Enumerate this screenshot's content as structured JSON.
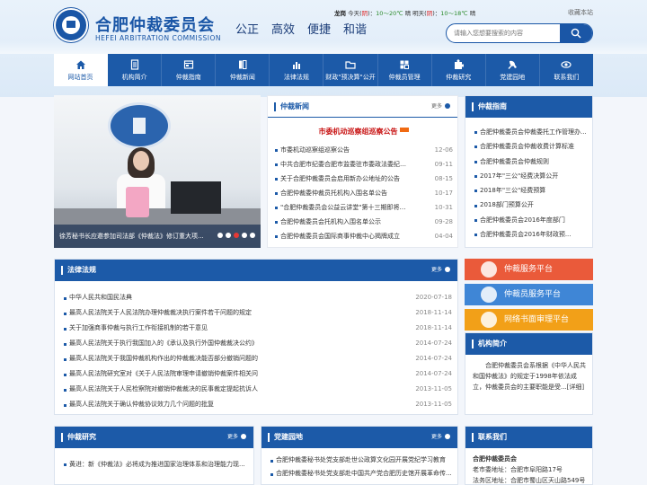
{
  "header": {
    "title": "合肥仲裁委员会",
    "subtitle": "HEFEI ARBITRATION COMMISSION",
    "slogans": [
      "公正",
      "高效",
      "便捷",
      "和谐"
    ],
    "weather": {
      "city": "龙岗",
      "today_label": "今天(",
      "today_cond": "阴",
      "today_close": ")：",
      "today_temp": "10～20℃",
      "today_word": "晴",
      "tomorrow_label": "明天(",
      "tomorrow_cond": "阴",
      "tomorrow_close": ")：",
      "tomorrow_temp": "10～18℃",
      "tomorrow_word": "晴"
    },
    "favorite": "收藏本站",
    "search_placeholder": "请输入您想要搜索的内容"
  },
  "nav": [
    {
      "label": "网站首页",
      "icon": "home-icon",
      "active": true
    },
    {
      "label": "机构简介",
      "icon": "document-icon"
    },
    {
      "label": "仲裁指南",
      "icon": "window-icon"
    },
    {
      "label": "仲裁新闻",
      "icon": "book-icon"
    },
    {
      "label": "法律法规",
      "icon": "chart-icon"
    },
    {
      "label": "财政\"预决算\"公开",
      "icon": "folder-icon"
    },
    {
      "label": "仲裁员管理",
      "icon": "pages-icon"
    },
    {
      "label": "仲裁研究",
      "icon": "puzzle-icon"
    },
    {
      "label": "党建园地",
      "icon": "party-icon"
    },
    {
      "label": "联系我们",
      "icon": "eye-icon"
    }
  ],
  "slider": {
    "caption": "徐芳秘书长应邀参加司法部《仲裁法》修订重大项..."
  },
  "news": {
    "title": "仲裁新闻",
    "more": "更多",
    "headline": "市委机动巡察组巡察公告",
    "items": [
      {
        "t": "市委机动巡察组巡察公告",
        "d": "12-06"
      },
      {
        "t": "中共合肥市纪委合肥市监委驻市委政法委纪检监察组...",
        "d": "09-11"
      },
      {
        "t": "关于合肥仲裁委员会启用新办公地址的公告",
        "d": "08-15"
      },
      {
        "t": "合肥仲裁委仲裁员托机构入围名单公告",
        "d": "10-17"
      },
      {
        "t": "\"合肥仲裁委员会公益云讲堂\"第十三期即将开讲啦...",
        "d": "10-31"
      },
      {
        "t": "合肥仲裁委员会托机构入围名单公示",
        "d": "09-28"
      },
      {
        "t": "合肥仲裁委员会国际商事仲裁中心揭牌成立",
        "d": "04-04"
      }
    ]
  },
  "guide": {
    "title": "仲裁指南",
    "items": [
      "合肥仲裁委员会仲裁委托工作管理办...",
      "合肥仲裁委员会仲裁收费计算标准",
      "合肥仲裁委员会仲裁规则",
      "2017年\"三公\"经费决算公开",
      "2018年\"三公\"经费预算",
      "2018部门预算公开",
      "合肥仲裁委员会2016年度部门",
      "合肥仲裁委员会2016年财政预..."
    ]
  },
  "law": {
    "title": "法律法规",
    "more": "更多",
    "items": [
      {
        "t": "中华人民共和国民法典",
        "d": "2020-07-18"
      },
      {
        "t": "最高人民法院关于人民法院办理仲裁裁决执行案件若干问题的规定",
        "d": "2018-11-14"
      },
      {
        "t": "关于加强商事仲裁与执行工作衔接机制的若干意见",
        "d": "2018-11-14"
      },
      {
        "t": "最高人民法院关于执行我国加入的《承认及执行外国仲裁裁决公约》",
        "d": "2014-07-24"
      },
      {
        "t": "最高人民法院关于我国仲裁机构作出的仲裁裁决能否部分撤销问题的",
        "d": "2014-07-24"
      },
      {
        "t": "最高人民法院研究室对《关于人民法院审理申请撤销仲裁案件相关问",
        "d": "2014-07-24"
      },
      {
        "t": "最高人民法院关于人民检察院对撤销仲裁裁决的民事裁定提起抗诉人",
        "d": "2013-11-05"
      },
      {
        "t": "最高人民法院关于确认仲裁协议效力几个问题的批复",
        "d": "2013-11-05"
      }
    ]
  },
  "services": [
    "仲裁服务平台",
    "仲裁员服务平台",
    "网络书面审理平台"
  ],
  "intro": {
    "title": "机构简介",
    "text": "合肥仲裁委员会系根据《中华人民共和国仲裁法》的规定于1998年依法成立，仲裁委员会的主要职能是受...[详细]"
  },
  "research": {
    "title": "仲裁研究",
    "more": "更多",
    "items": [
      {
        "t": "黄进：新《仲裁法》必将成为推进国家治理体系和治理能力现..."
      }
    ]
  },
  "party": {
    "title": "党建园地",
    "more": "更多",
    "items": [
      {
        "t": "合肥仲裁委秘书处党支部赴世公政算文化园开展党纪学习教育"
      },
      {
        "t": "合肥仲裁委秘书处党支部赴中国共产党合肥历史馆开展革命传..."
      }
    ]
  },
  "contact": {
    "title": "联系我们",
    "name": "合肥仲裁委员会",
    "addr1": "老市委地址：合肥市阜阳路17号",
    "addr2": "法务区地址：合肥市蜀山区天山路549号"
  },
  "colors": {
    "primary": "#1c5aa8",
    "headline": "#c81414",
    "svc1": "#ea5a3a",
    "svc2": "#3f86d6",
    "svc3": "#f2a018"
  }
}
